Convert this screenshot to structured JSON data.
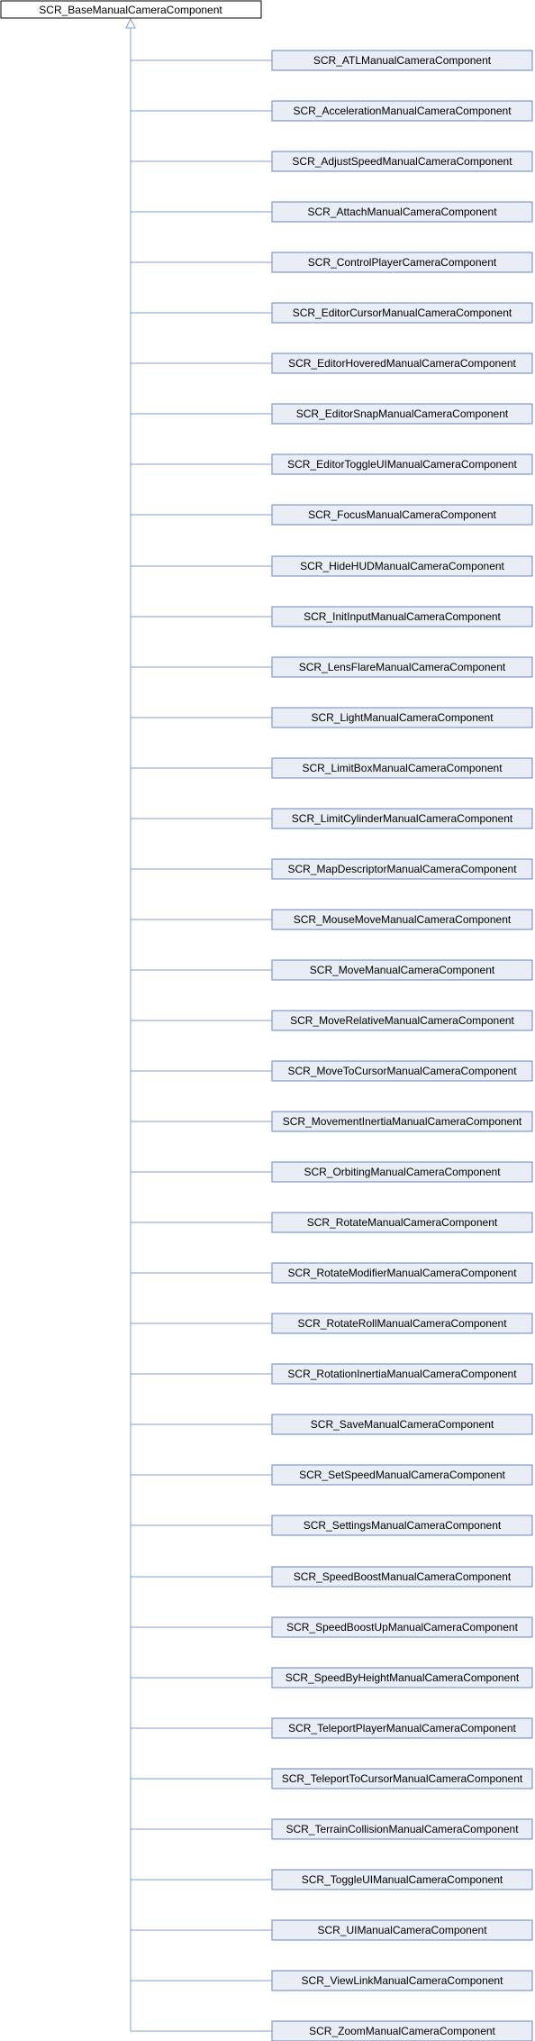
{
  "diagram": {
    "base_class": "SCR_BaseManualCameraComponent",
    "derived_classes": [
      "SCR_ATLManualCameraComponent",
      "SCR_AccelerationManualCameraComponent",
      "SCR_AdjustSpeedManualCameraComponent",
      "SCR_AttachManualCameraComponent",
      "SCR_ControlPlayerCameraComponent",
      "SCR_EditorCursorManualCameraComponent",
      "SCR_EditorHoveredManualCameraComponent",
      "SCR_EditorSnapManualCameraComponent",
      "SCR_EditorToggleUIManualCameraComponent",
      "SCR_FocusManualCameraComponent",
      "SCR_HideHUDManualCameraComponent",
      "SCR_InitInputManualCameraComponent",
      "SCR_LensFlareManualCameraComponent",
      "SCR_LightManualCameraComponent",
      "SCR_LimitBoxManualCameraComponent",
      "SCR_LimitCylinderManualCameraComponent",
      "SCR_MapDescriptorManualCameraComponent",
      "SCR_MouseMoveManualCameraComponent",
      "SCR_MoveManualCameraComponent",
      "SCR_MoveRelativeManualCameraComponent",
      "SCR_MoveToCursorManualCameraComponent",
      "SCR_MovementInertiaManualCameraComponent",
      "SCR_OrbitingManualCameraComponent",
      "SCR_RotateManualCameraComponent",
      "SCR_RotateModifierManualCameraComponent",
      "SCR_RotateRollManualCameraComponent",
      "SCR_RotationInertiaManualCameraComponent",
      "SCR_SaveManualCameraComponent",
      "SCR_SetSpeedManualCameraComponent",
      "SCR_SettingsManualCameraComponent",
      "SCR_SpeedBoostManualCameraComponent",
      "SCR_SpeedBoostUpManualCameraComponent",
      "SCR_SpeedByHeightManualCameraComponent",
      "SCR_TeleportPlayerManualCameraComponent",
      "SCR_TeleportToCursorManualCameraComponent",
      "SCR_TerrainCollisionManualCameraComponent",
      "SCR_ToggleUIManualCameraComponent",
      "SCR_UIManualCameraComponent",
      "SCR_ViewLinkManualCameraComponent",
      "SCR_ZoomManualCameraComponent"
    ],
    "colors": {
      "edge": "#7ea0d0",
      "child_fill": "#e8edf6",
      "child_border": "#6b87c0",
      "base_fill": "#ffffff",
      "base_border": "#000000"
    }
  }
}
